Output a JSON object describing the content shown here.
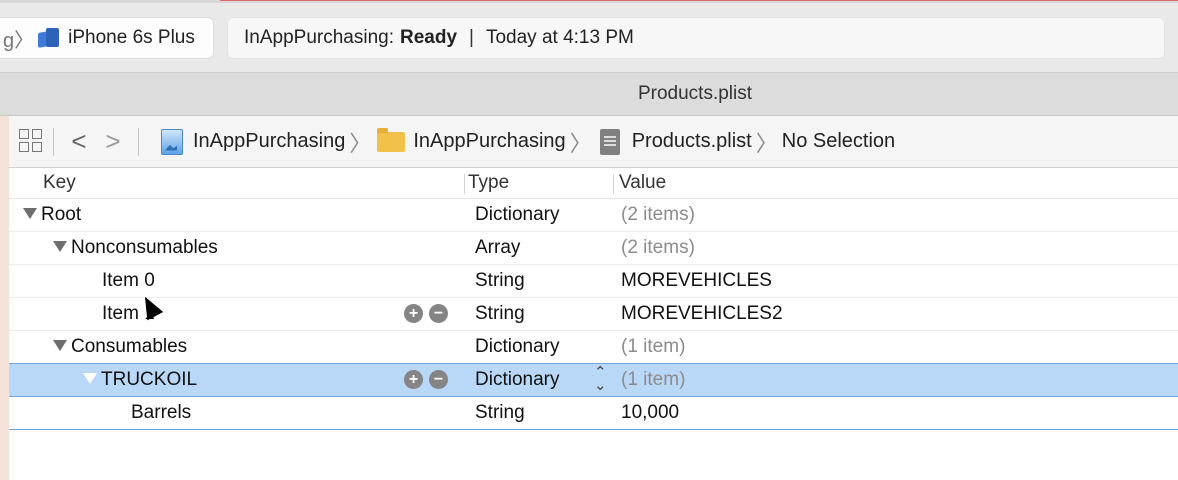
{
  "toolbar": {
    "scheme_chevron": "g〉",
    "device": "iPhone 6s Plus",
    "activity": {
      "app": "InAppPurchasing:",
      "status": "Ready",
      "separator": "|",
      "time": "Today at 4:13 PM"
    }
  },
  "editor_title": "Products.plist",
  "jumpbar": {
    "back": "<",
    "forward": ">",
    "crumbs": [
      "InAppPurchasing",
      "InAppPurchasing",
      "Products.plist",
      "No Selection"
    ],
    "chevron": "〉"
  },
  "columns": {
    "key": "Key",
    "type": "Type",
    "value": "Value"
  },
  "rows": [
    {
      "key": "Root",
      "type": "Dictionary",
      "value": "(2 items)"
    },
    {
      "key": "Nonconsumables",
      "type": "Array",
      "value": "(2 items)"
    },
    {
      "key": "Item 0",
      "type": "String",
      "value": "MOREVEHICLES"
    },
    {
      "key": "Item 1",
      "type": "String",
      "value": "MOREVEHICLES2"
    },
    {
      "key": "Consumables",
      "type": "Dictionary",
      "value": "(1 item)"
    },
    {
      "key": "TRUCKOIL",
      "type": "Dictionary",
      "value": "(1 item)",
      "selected": true
    },
    {
      "key": "Barrels",
      "type": "String",
      "value": "10,000"
    }
  ],
  "icons": {
    "add": "+",
    "remove": "−",
    "stepper_up": "⌃",
    "stepper_down": "⌄"
  },
  "colors": {
    "selection": "#b9d7f7",
    "selection_border": "#6ea4e0"
  }
}
